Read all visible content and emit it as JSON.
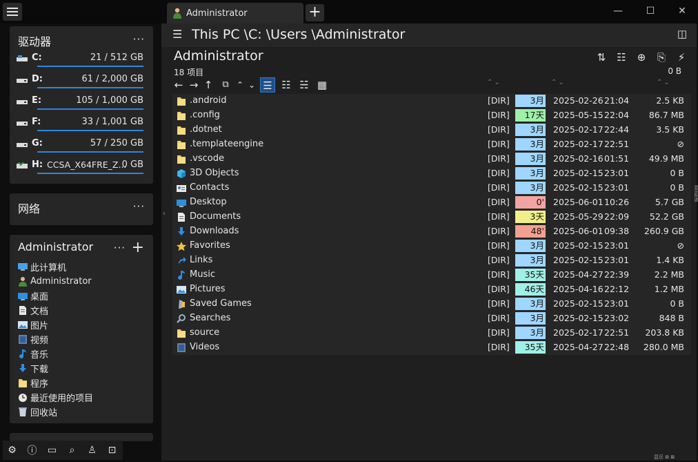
{
  "tab": {
    "title": "Administrator",
    "new_tab": "+"
  },
  "window": {
    "minimize": "—",
    "maximize": "☐",
    "close": "✕"
  },
  "drives_panel": {
    "title": "驱动器",
    "more": "···",
    "drives": [
      {
        "letter": "C:",
        "size": "21 / 512 GB",
        "used_fraction": 0.041
      },
      {
        "letter": "D:",
        "size": "61 / 2,000 GB",
        "used_fraction": 0.031
      },
      {
        "letter": "E:",
        "size": "105 / 1,000 GB",
        "used_fraction": 0.105
      },
      {
        "letter": "F:",
        "size": "33 / 1,001 GB",
        "used_fraction": 0.033
      },
      {
        "letter": "G:",
        "size": "57 / 250 GB",
        "used_fraction": 0.228
      },
      {
        "letter": "H:",
        "label": "CCSA_X64FRE_Z...",
        "size": "0 GB",
        "used_fraction": 1.0
      }
    ]
  },
  "network_panel": {
    "title": "网络",
    "more": "···"
  },
  "user_panel": {
    "title": "Administrator",
    "more": "···",
    "add": "+",
    "items": [
      {
        "label": "此计算机",
        "icon": "computer-icon"
      },
      {
        "label": "Administrator",
        "icon": "user-icon"
      },
      {
        "label": "桌面",
        "icon": "desktop-icon"
      },
      {
        "label": "文档",
        "icon": "document-icon"
      },
      {
        "label": "图片",
        "icon": "picture-icon"
      },
      {
        "label": "视频",
        "icon": "video-icon"
      },
      {
        "label": "音乐",
        "icon": "music-icon"
      },
      {
        "label": "下载",
        "icon": "download-icon"
      },
      {
        "label": "程序",
        "icon": "folder-icon"
      },
      {
        "label": "最近使用的项目",
        "icon": "recent-icon"
      },
      {
        "label": "回收站",
        "icon": "recycle-bin-icon"
      }
    ]
  },
  "path": {
    "text": "This PC \\C: \\Users \\Administrator"
  },
  "folder": {
    "title": "Administrator",
    "item_count": "18 项目",
    "total_size": "0 B"
  },
  "files": [
    {
      "name": ".android",
      "type": "[DIR]",
      "age": "3月",
      "age_color": "#9fd6ff",
      "date": "2025-02-26",
      "time": "21:04",
      "size": "2.5 KB",
      "icon": "folder-icon"
    },
    {
      "name": ".config",
      "type": "[DIR]",
      "age": "17天",
      "age_color": "#9ff0a8",
      "date": "2025-05-15",
      "time": "22:04",
      "size": "86.7 MB",
      "icon": "folder-icon"
    },
    {
      "name": ".dotnet",
      "type": "[DIR]",
      "age": "3月",
      "age_color": "#9fd6ff",
      "date": "2025-02-17",
      "time": "22:44",
      "size": "3.5 KB",
      "icon": "folder-icon"
    },
    {
      "name": ".templateengine",
      "type": "[DIR]",
      "age": "3月",
      "age_color": "#9fd6ff",
      "date": "2025-02-17",
      "time": "22:51",
      "size": "⊘",
      "icon": "folder-icon"
    },
    {
      "name": ".vscode",
      "type": "[DIR]",
      "age": "3月",
      "age_color": "#9fd6ff",
      "date": "2025-02-16",
      "time": "01:51",
      "size": "49.9 MB",
      "icon": "folder-icon"
    },
    {
      "name": "3D Objects",
      "type": "[DIR]",
      "age": "3月",
      "age_color": "#9fd6ff",
      "date": "2025-02-15",
      "time": "23:01",
      "size": "0 B",
      "icon": "cube-icon"
    },
    {
      "name": "Contacts",
      "type": "[DIR]",
      "age": "3月",
      "age_color": "#9fd6ff",
      "date": "2025-02-15",
      "time": "23:01",
      "size": "0 B",
      "icon": "contacts-icon"
    },
    {
      "name": "Desktop",
      "type": "[DIR]",
      "age": "0'",
      "age_color": "#f4a3a3",
      "date": "2025-06-01",
      "time": "10:26",
      "size": "5.7 GB",
      "icon": "desktop-icon"
    },
    {
      "name": "Documents",
      "type": "[DIR]",
      "age": "3天",
      "age_color": "#f0f08a",
      "date": "2025-05-29",
      "time": "22:09",
      "size": "52.2 GB",
      "icon": "document-icon"
    },
    {
      "name": "Downloads",
      "type": "[DIR]",
      "age": "48'",
      "age_color": "#f4a090",
      "date": "2025-06-01",
      "time": "09:38",
      "size": "260.9 GB",
      "icon": "download-icon"
    },
    {
      "name": "Favorites",
      "type": "[DIR]",
      "age": "3月",
      "age_color": "#9fd6ff",
      "date": "2025-02-15",
      "time": "23:01",
      "size": "⊘",
      "icon": "star-icon"
    },
    {
      "name": "Links",
      "type": "[DIR]",
      "age": "3月",
      "age_color": "#9fd6ff",
      "date": "2025-02-15",
      "time": "23:01",
      "size": "1.4 KB",
      "icon": "link-icon"
    },
    {
      "name": "Music",
      "type": "[DIR]",
      "age": "35天",
      "age_color": "#9ff0e6",
      "date": "2025-04-27",
      "time": "22:39",
      "size": "2.2 MB",
      "icon": "music-icon"
    },
    {
      "name": "Pictures",
      "type": "[DIR]",
      "age": "46天",
      "age_color": "#9ff0e6",
      "date": "2025-04-16",
      "time": "22:12",
      "size": "1.2 MB",
      "icon": "picture-icon"
    },
    {
      "name": "Saved Games",
      "type": "[DIR]",
      "age": "3月",
      "age_color": "#9fd6ff",
      "date": "2025-02-15",
      "time": "23:01",
      "size": "0 B",
      "icon": "game-icon"
    },
    {
      "name": "Searches",
      "type": "[DIR]",
      "age": "3月",
      "age_color": "#9fd6ff",
      "date": "2025-02-15",
      "time": "23:02",
      "size": "848 B",
      "icon": "search-icon"
    },
    {
      "name": "source",
      "type": "[DIR]",
      "age": "3月",
      "age_color": "#9fd6ff",
      "date": "2025-02-17",
      "time": "22:51",
      "size": "203.8 KB",
      "icon": "folder-icon"
    },
    {
      "name": "Videos",
      "type": "[DIR]",
      "age": "35天",
      "age_color": "#9ff0e6",
      "date": "2025-04-27",
      "time": "22:48",
      "size": "280.0 MB",
      "icon": "video-icon"
    }
  ],
  "edge_label": "显示所选",
  "status_label": "显示 ⊞ ⊠"
}
